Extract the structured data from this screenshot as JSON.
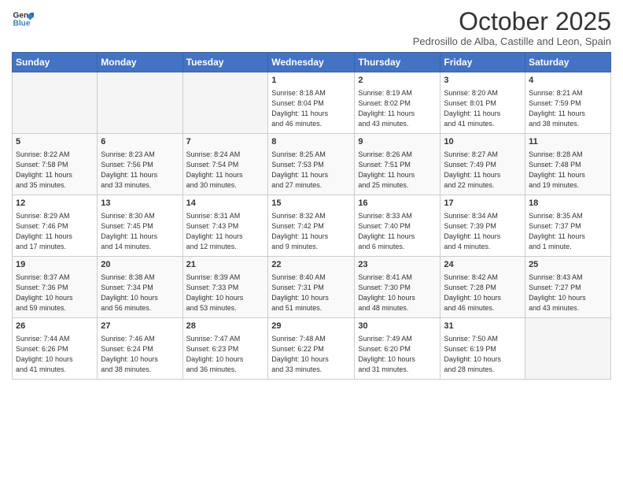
{
  "header": {
    "logo_line1": "General",
    "logo_line2": "Blue",
    "month": "October 2025",
    "location": "Pedrosillo de Alba, Castille and Leon, Spain"
  },
  "weekdays": [
    "Sunday",
    "Monday",
    "Tuesday",
    "Wednesday",
    "Thursday",
    "Friday",
    "Saturday"
  ],
  "weeks": [
    [
      {
        "day": "",
        "info": ""
      },
      {
        "day": "",
        "info": ""
      },
      {
        "day": "",
        "info": ""
      },
      {
        "day": "1",
        "info": "Sunrise: 8:18 AM\nSunset: 8:04 PM\nDaylight: 11 hours\nand 46 minutes."
      },
      {
        "day": "2",
        "info": "Sunrise: 8:19 AM\nSunset: 8:02 PM\nDaylight: 11 hours\nand 43 minutes."
      },
      {
        "day": "3",
        "info": "Sunrise: 8:20 AM\nSunset: 8:01 PM\nDaylight: 11 hours\nand 41 minutes."
      },
      {
        "day": "4",
        "info": "Sunrise: 8:21 AM\nSunset: 7:59 PM\nDaylight: 11 hours\nand 38 minutes."
      }
    ],
    [
      {
        "day": "5",
        "info": "Sunrise: 8:22 AM\nSunset: 7:58 PM\nDaylight: 11 hours\nand 35 minutes."
      },
      {
        "day": "6",
        "info": "Sunrise: 8:23 AM\nSunset: 7:56 PM\nDaylight: 11 hours\nand 33 minutes."
      },
      {
        "day": "7",
        "info": "Sunrise: 8:24 AM\nSunset: 7:54 PM\nDaylight: 11 hours\nand 30 minutes."
      },
      {
        "day": "8",
        "info": "Sunrise: 8:25 AM\nSunset: 7:53 PM\nDaylight: 11 hours\nand 27 minutes."
      },
      {
        "day": "9",
        "info": "Sunrise: 8:26 AM\nSunset: 7:51 PM\nDaylight: 11 hours\nand 25 minutes."
      },
      {
        "day": "10",
        "info": "Sunrise: 8:27 AM\nSunset: 7:49 PM\nDaylight: 11 hours\nand 22 minutes."
      },
      {
        "day": "11",
        "info": "Sunrise: 8:28 AM\nSunset: 7:48 PM\nDaylight: 11 hours\nand 19 minutes."
      }
    ],
    [
      {
        "day": "12",
        "info": "Sunrise: 8:29 AM\nSunset: 7:46 PM\nDaylight: 11 hours\nand 17 minutes."
      },
      {
        "day": "13",
        "info": "Sunrise: 8:30 AM\nSunset: 7:45 PM\nDaylight: 11 hours\nand 14 minutes."
      },
      {
        "day": "14",
        "info": "Sunrise: 8:31 AM\nSunset: 7:43 PM\nDaylight: 11 hours\nand 12 minutes."
      },
      {
        "day": "15",
        "info": "Sunrise: 8:32 AM\nSunset: 7:42 PM\nDaylight: 11 hours\nand 9 minutes."
      },
      {
        "day": "16",
        "info": "Sunrise: 8:33 AM\nSunset: 7:40 PM\nDaylight: 11 hours\nand 6 minutes."
      },
      {
        "day": "17",
        "info": "Sunrise: 8:34 AM\nSunset: 7:39 PM\nDaylight: 11 hours\nand 4 minutes."
      },
      {
        "day": "18",
        "info": "Sunrise: 8:35 AM\nSunset: 7:37 PM\nDaylight: 11 hours\nand 1 minute."
      }
    ],
    [
      {
        "day": "19",
        "info": "Sunrise: 8:37 AM\nSunset: 7:36 PM\nDaylight: 10 hours\nand 59 minutes."
      },
      {
        "day": "20",
        "info": "Sunrise: 8:38 AM\nSunset: 7:34 PM\nDaylight: 10 hours\nand 56 minutes."
      },
      {
        "day": "21",
        "info": "Sunrise: 8:39 AM\nSunset: 7:33 PM\nDaylight: 10 hours\nand 53 minutes."
      },
      {
        "day": "22",
        "info": "Sunrise: 8:40 AM\nSunset: 7:31 PM\nDaylight: 10 hours\nand 51 minutes."
      },
      {
        "day": "23",
        "info": "Sunrise: 8:41 AM\nSunset: 7:30 PM\nDaylight: 10 hours\nand 48 minutes."
      },
      {
        "day": "24",
        "info": "Sunrise: 8:42 AM\nSunset: 7:28 PM\nDaylight: 10 hours\nand 46 minutes."
      },
      {
        "day": "25",
        "info": "Sunrise: 8:43 AM\nSunset: 7:27 PM\nDaylight: 10 hours\nand 43 minutes."
      }
    ],
    [
      {
        "day": "26",
        "info": "Sunrise: 7:44 AM\nSunset: 6:26 PM\nDaylight: 10 hours\nand 41 minutes."
      },
      {
        "day": "27",
        "info": "Sunrise: 7:46 AM\nSunset: 6:24 PM\nDaylight: 10 hours\nand 38 minutes."
      },
      {
        "day": "28",
        "info": "Sunrise: 7:47 AM\nSunset: 6:23 PM\nDaylight: 10 hours\nand 36 minutes."
      },
      {
        "day": "29",
        "info": "Sunrise: 7:48 AM\nSunset: 6:22 PM\nDaylight: 10 hours\nand 33 minutes."
      },
      {
        "day": "30",
        "info": "Sunrise: 7:49 AM\nSunset: 6:20 PM\nDaylight: 10 hours\nand 31 minutes."
      },
      {
        "day": "31",
        "info": "Sunrise: 7:50 AM\nSunset: 6:19 PM\nDaylight: 10 hours\nand 28 minutes."
      },
      {
        "day": "",
        "info": ""
      }
    ]
  ]
}
